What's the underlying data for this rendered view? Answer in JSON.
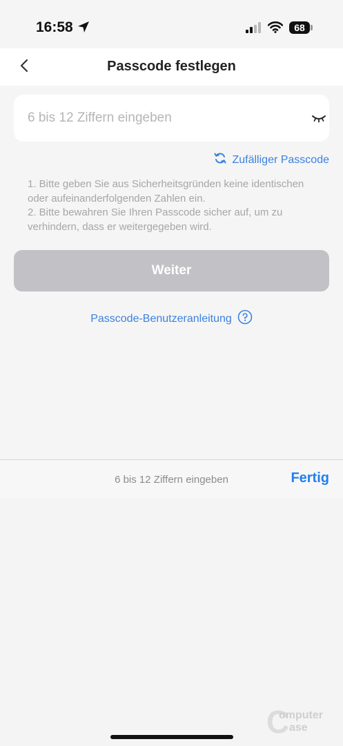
{
  "status_bar": {
    "time": "16:58",
    "battery_level": "68",
    "icons": [
      "location-arrow-icon",
      "cellular-signal-icon",
      "wifi-icon",
      "battery-icon"
    ]
  },
  "header": {
    "title": "Passcode festlegen",
    "back_icon": "chevron-left-icon"
  },
  "passcode": {
    "placeholder": "6 bis 12 Ziffern eingeben",
    "value": "",
    "visibility_icon": "eye-closed-icon"
  },
  "random_passcode": {
    "label": "Zufälliger Passcode",
    "icon": "refresh-icon"
  },
  "hints": [
    "1. Bitte geben Sie aus Sicherheitsgründen keine identischen oder aufeinanderfolgenden Zahlen ein.",
    "2. Bitte bewahren Sie Ihren Passcode sicher auf, um zu verhindern, dass er weitergegeben wird."
  ],
  "next_button": {
    "label": "Weiter",
    "enabled": false
  },
  "guide": {
    "label": "Passcode-Benutzeranleitung",
    "icon": "help-circle-icon"
  },
  "keyboard_toolbar": {
    "hint": "6 bis 12 Ziffern eingeben",
    "done_label": "Fertig"
  },
  "watermark": {
    "line1": "omputer",
    "line2": "ase"
  },
  "colors": {
    "accent": "#3a82e0",
    "done": "#1f7ff0",
    "button_disabled": "#c2c2c6",
    "background": "#f5f5f5"
  }
}
